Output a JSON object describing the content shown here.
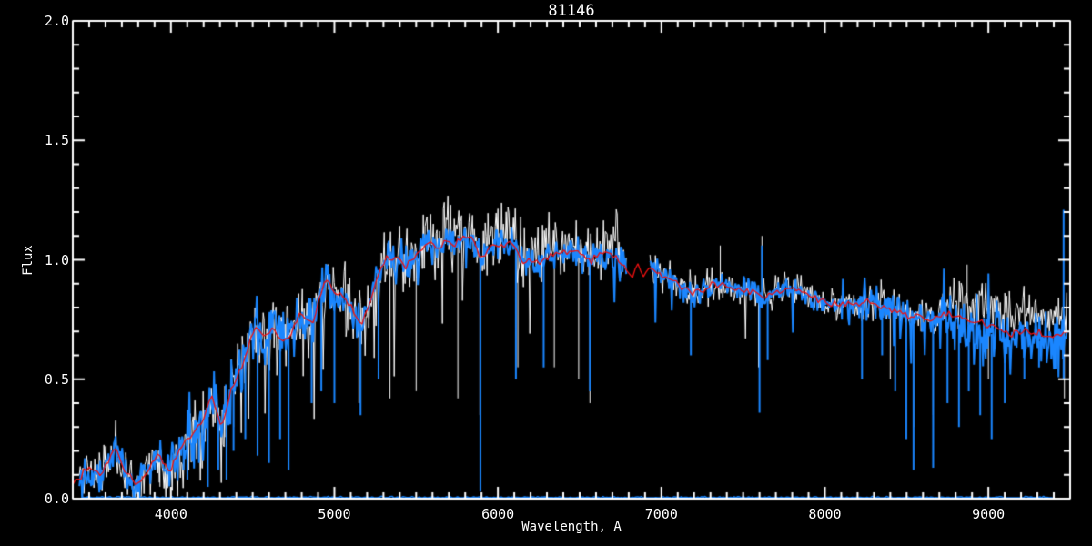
{
  "chart_data": {
    "type": "line",
    "title": "81146",
    "xlabel": "Wavelength, A",
    "ylabel": "Flux",
    "xlim": [
      3400,
      9500
    ],
    "ylim": [
      0.0,
      2.0
    ],
    "grid": false,
    "legend": false,
    "background_color": "#000000",
    "axis_color": "#ffffff",
    "x_major_ticks": [
      4000,
      5000,
      6000,
      7000,
      8000,
      9000
    ],
    "x_tick_labels": [
      "4000",
      "5000",
      "6000",
      "7000",
      "8000",
      "9000"
    ],
    "x_minor_step": 100,
    "y_major_ticks": [
      0.0,
      0.5,
      1.0,
      1.5,
      2.0
    ],
    "y_tick_labels": [
      "0.0",
      "0.5",
      "1.0",
      "1.5",
      "2.0"
    ],
    "y_minor_step": 0.1,
    "continuum_points": [
      [
        3400,
        0.065
      ],
      [
        3450,
        0.09
      ],
      [
        3495,
        0.135
      ],
      [
        3560,
        0.1
      ],
      [
        3615,
        0.155
      ],
      [
        3660,
        0.21
      ],
      [
        3705,
        0.14
      ],
      [
        3790,
        0.05
      ],
      [
        3860,
        0.12
      ],
      [
        3917,
        0.185
      ],
      [
        3995,
        0.12
      ],
      [
        4070,
        0.22
      ],
      [
        4140,
        0.28
      ],
      [
        4200,
        0.33
      ],
      [
        4250,
        0.43
      ],
      [
        4310,
        0.3
      ],
      [
        4370,
        0.46
      ],
      [
        4430,
        0.55
      ],
      [
        4470,
        0.62
      ],
      [
        4515,
        0.72
      ],
      [
        4570,
        0.68
      ],
      [
        4620,
        0.72
      ],
      [
        4690,
        0.65
      ],
      [
        4730,
        0.68
      ],
      [
        4790,
        0.78
      ],
      [
        4861,
        0.72
      ],
      [
        4945,
        0.92
      ],
      [
        5010,
        0.86
      ],
      [
        5068,
        0.84
      ],
      [
        5168,
        0.72
      ],
      [
        5307,
        1.01
      ],
      [
        5400,
        1.0
      ],
      [
        5440,
        0.97
      ],
      [
        5585,
        1.08
      ],
      [
        5624,
        1.04
      ],
      [
        5680,
        1.09
      ],
      [
        5735,
        1.06
      ],
      [
        5790,
        1.1
      ],
      [
        5850,
        1.08
      ],
      [
        5893,
        1.01
      ],
      [
        5958,
        1.06
      ],
      [
        6097,
        1.07
      ],
      [
        6142,
        1.0
      ],
      [
        6248,
        0.99
      ],
      [
        6370,
        1.03
      ],
      [
        6480,
        1.04
      ],
      [
        6570,
        1.0
      ],
      [
        6650,
        1.03
      ],
      [
        6760,
        1.0
      ],
      [
        6820,
        0.93
      ],
      [
        6860,
        0.99
      ],
      [
        6890,
        0.92
      ],
      [
        6920,
        0.98
      ],
      [
        6960,
        0.94
      ],
      [
        7020,
        0.93
      ],
      [
        7100,
        0.9
      ],
      [
        7180,
        0.87
      ],
      [
        7250,
        0.86
      ],
      [
        7320,
        0.9
      ],
      [
        7400,
        0.89
      ],
      [
        7480,
        0.88
      ],
      [
        7560,
        0.87
      ],
      [
        7620,
        0.84
      ],
      [
        7700,
        0.87
      ],
      [
        7780,
        0.88
      ],
      [
        7860,
        0.86
      ],
      [
        7940,
        0.84
      ],
      [
        8020,
        0.82
      ],
      [
        8100,
        0.81
      ],
      [
        8180,
        0.81
      ],
      [
        8260,
        0.82
      ],
      [
        8340,
        0.81
      ],
      [
        8420,
        0.79
      ],
      [
        8500,
        0.77
      ],
      [
        8580,
        0.76
      ],
      [
        8660,
        0.75
      ],
      [
        8740,
        0.77
      ],
      [
        8820,
        0.76
      ],
      [
        8900,
        0.74
      ],
      [
        8980,
        0.73
      ],
      [
        9060,
        0.71
      ],
      [
        9140,
        0.69
      ],
      [
        9220,
        0.71
      ],
      [
        9300,
        0.69
      ],
      [
        9380,
        0.68
      ],
      [
        9480,
        0.7
      ]
    ],
    "series": [
      {
        "name": "observed spectrum A (white)",
        "color": "#ffffff",
        "line_width": 1,
        "step": 1,
        "base": "continuum_points",
        "range": [
          3440,
          9480
        ],
        "gap": [
          6790,
          6930
        ],
        "noise_amplitude_regions": [
          [
            3440,
            4000,
            0.07
          ],
          [
            4000,
            4450,
            0.11
          ],
          [
            4450,
            5000,
            0.1
          ],
          [
            5000,
            5600,
            0.1
          ],
          [
            5600,
            6790,
            0.095
          ],
          [
            6930,
            7600,
            0.055
          ],
          [
            7600,
            8100,
            0.05
          ],
          [
            8100,
            8700,
            0.055
          ],
          [
            8700,
            9480,
            0.07
          ]
        ],
        "offset_regions": [
          [
            5550,
            6790,
            0.03
          ],
          [
            8700,
            9480,
            0.07
          ]
        ],
        "random_spike_regions": [
          {
            "range": [
              3500,
              4300
            ],
            "prob": 0.02,
            "extra": [
              0.05,
              0.15
            ],
            "dir": -1
          },
          {
            "range": [
              4300,
              6790
            ],
            "prob": 0.025,
            "extra": [
              0.1,
              0.4
            ],
            "dir": -1
          },
          {
            "range": [
              6930,
              8100
            ],
            "prob": 0.015,
            "extra": [
              0.08,
              0.25
            ],
            "dir": -1
          }
        ],
        "down_spikes": [
          [
            3933,
            0.05
          ],
          [
            3968,
            0.1
          ],
          [
            4101,
            0.18
          ],
          [
            4226,
            0.15
          ],
          [
            4340,
            0.22
          ],
          [
            4383,
            0.3
          ],
          [
            4861,
            0.45
          ],
          [
            5150,
            0.4
          ],
          [
            5340,
            0.42
          ],
          [
            5500,
            0.45
          ],
          [
            5755,
            0.42
          ],
          [
            5890,
            0.35
          ],
          [
            6122,
            0.55
          ],
          [
            6345,
            0.55
          ],
          [
            6494,
            0.5
          ],
          [
            6563,
            0.4
          ],
          [
            7594,
            0.55
          ],
          [
            8400,
            0.5
          ],
          [
            8542,
            0.3
          ],
          [
            8662,
            0.35
          ],
          [
            9000,
            0.5
          ],
          [
            9465,
            0.42
          ]
        ],
        "up_spikes": [
          [
            7360,
            1.06
          ],
          [
            7615,
            1.1
          ],
          [
            8870,
            0.98
          ]
        ]
      },
      {
        "name": "observed spectrum B (blue)",
        "color": "#1a86ff",
        "line_width": 2,
        "step": 1,
        "base": "continuum_points",
        "range": [
          3440,
          9480
        ],
        "gap": [
          6790,
          6930
        ],
        "noise_amplitude_regions": [
          [
            3440,
            4000,
            0.055
          ],
          [
            4000,
            4450,
            0.1
          ],
          [
            4450,
            5000,
            0.08
          ],
          [
            5000,
            5600,
            0.05
          ],
          [
            5600,
            6790,
            0.045
          ],
          [
            6930,
            7600,
            0.04
          ],
          [
            7600,
            8100,
            0.035
          ],
          [
            8100,
            8700,
            0.05
          ],
          [
            8700,
            9480,
            0.085
          ]
        ],
        "offset_regions": [
          [
            8700,
            9480,
            -0.03
          ]
        ],
        "random_spike_regions": [
          {
            "range": [
              4000,
              4900
            ],
            "prob": 0.03,
            "extra": [
              0.1,
              0.3
            ],
            "dir": -1
          },
          {
            "range": [
              5000,
              6790
            ],
            "prob": 0.01,
            "extra": [
              0.05,
              0.2
            ],
            "dir": -1
          },
          {
            "range": [
              6930,
              8100
            ],
            "prob": 0.02,
            "extra": [
              0.1,
              0.25
            ],
            "dir": -1
          },
          {
            "range": [
              8100,
              9480
            ],
            "prob": 0.04,
            "extra": [
              0.05,
              0.2
            ],
            "dir": 0
          }
        ],
        "down_spikes": [
          [
            3990,
            0.1
          ],
          [
            4026,
            0.18
          ],
          [
            4077,
            0.12
          ],
          [
            4101,
            0.08
          ],
          [
            4172,
            0.15
          ],
          [
            4226,
            0.05
          ],
          [
            4290,
            0.12
          ],
          [
            4340,
            0.08
          ],
          [
            4383,
            0.2
          ],
          [
            4455,
            0.25
          ],
          [
            4530,
            0.18
          ],
          [
            4600,
            0.15
          ],
          [
            4668,
            0.25
          ],
          [
            4720,
            0.12
          ],
          [
            4861,
            0.4
          ],
          [
            4920,
            0.45
          ],
          [
            5000,
            0.4
          ],
          [
            5160,
            0.35
          ],
          [
            5270,
            0.5
          ],
          [
            5893,
            0.03
          ],
          [
            6110,
            0.5
          ],
          [
            6280,
            0.55
          ],
          [
            6563,
            0.45
          ],
          [
            7180,
            0.6
          ],
          [
            7600,
            0.36
          ],
          [
            7650,
            0.58
          ],
          [
            8227,
            0.5
          ],
          [
            8350,
            0.6
          ],
          [
            8430,
            0.45
          ],
          [
            8498,
            0.25
          ],
          [
            8542,
            0.12
          ],
          [
            8662,
            0.13
          ],
          [
            8750,
            0.4
          ],
          [
            8820,
            0.3
          ],
          [
            8880,
            0.45
          ],
          [
            8950,
            0.35
          ],
          [
            9020,
            0.25
          ],
          [
            9100,
            0.4
          ],
          [
            9220,
            0.5
          ],
          [
            9310,
            0.55
          ],
          [
            9460,
            0.5
          ]
        ],
        "up_spikes": [
          [
            7615,
            1.06
          ],
          [
            9460,
            1.21
          ]
        ]
      },
      {
        "name": "zero / sky level line (blue)",
        "color": "#1a86ff",
        "line_width": 1.5,
        "step": 2,
        "constant_flux": 0.005,
        "range": [
          3460,
          9395
        ],
        "noise_amplitude_regions": [
          [
            3460,
            9395,
            0.003
          ]
        ],
        "offset_regions": [],
        "random_spike_regions": [],
        "down_spikes": [],
        "up_spikes": []
      },
      {
        "name": "template fit (red)",
        "color": "#ef1010",
        "line_width": 1.3,
        "step": 3,
        "base": "continuum_points",
        "range": [
          3400,
          9480
        ],
        "noise_amplitude_regions": [
          [
            3400,
            9480,
            0.012
          ]
        ],
        "offset_regions": [],
        "random_spike_regions": [],
        "down_spikes": [],
        "up_spikes": []
      }
    ]
  }
}
